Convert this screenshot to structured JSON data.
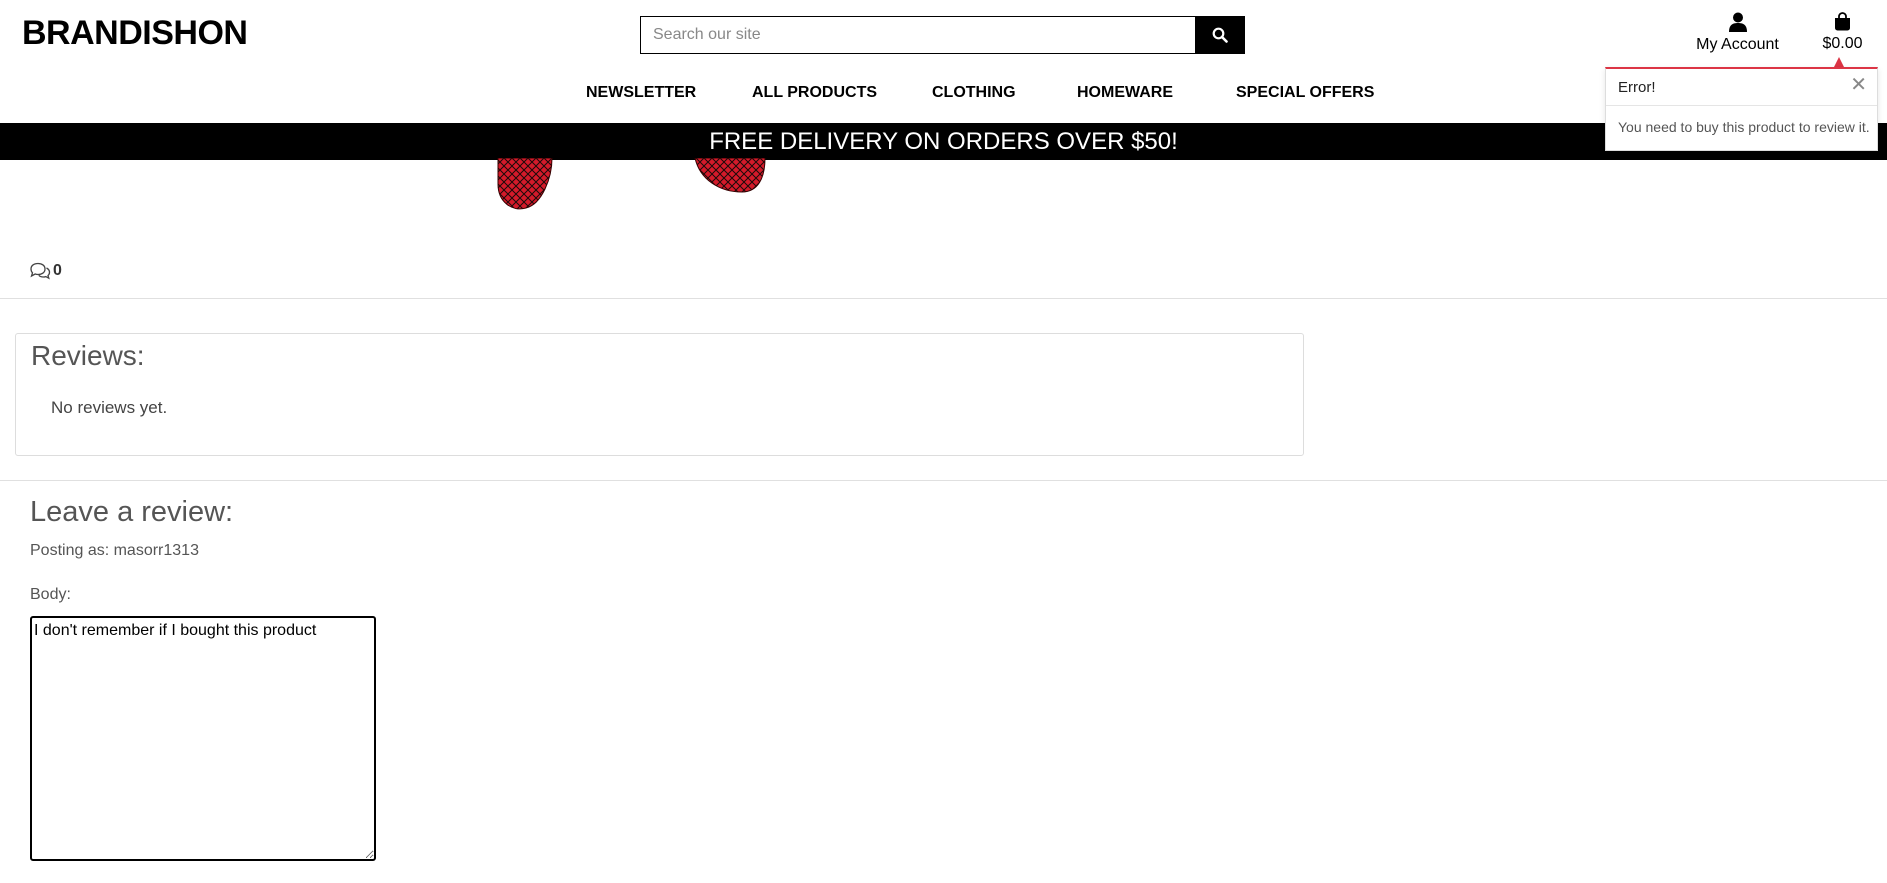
{
  "header": {
    "logo": "BRANDISHON",
    "search_placeholder": "Search our site",
    "account_label": "My Account",
    "cart_total": "$0.00"
  },
  "nav": {
    "items": [
      "NEWSLETTER",
      "ALL PRODUCTS",
      "CLOTHING",
      "HOMEWARE",
      "SPECIAL OFFERS"
    ]
  },
  "banner": {
    "text": "FREE DELIVERY ON ORDERS OVER $50!"
  },
  "product": {
    "comment_count": "0"
  },
  "reviews": {
    "title": "Reviews:",
    "empty_text": "No reviews yet."
  },
  "review_form": {
    "title": "Leave a review:",
    "posting_as": "Posting as: masorr1313",
    "body_label": "Body:",
    "body_value": "I don't remember if I bought this product"
  },
  "toast": {
    "title": "Error!",
    "close": "✕",
    "message": "You need to buy this product to review it.",
    "accent_color": "#dc3545"
  },
  "icons": {
    "search": "search-icon",
    "account": "user-icon",
    "cart": "shopping-bag-icon",
    "comments": "comments-icon"
  }
}
